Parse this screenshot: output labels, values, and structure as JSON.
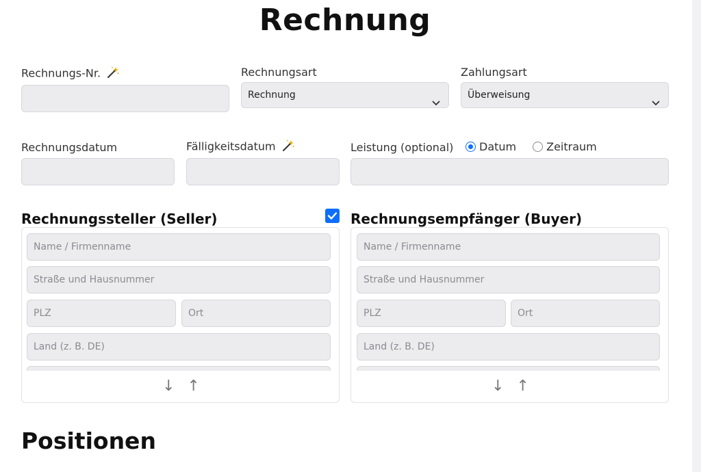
{
  "header": {
    "title": "Rechnung"
  },
  "row1": {
    "invoice_no_label": "Rechnungs-Nr.",
    "invoice_type_label": "Rechnungsart",
    "invoice_type_value": "Rechnung",
    "payment_type_label": "Zahlungsart",
    "payment_type_value": "Überweisung"
  },
  "row2": {
    "invoice_date_label": "Rechnungsdatum",
    "due_date_label": "Fälligkeitsdatum",
    "service_label": "Leistung (optional)",
    "radio_date": "Datum",
    "radio_period": "Zeitraum",
    "selected": "Datum"
  },
  "seller": {
    "title": "Rechnungssteller (Seller)",
    "checkbox_checked": true,
    "name_placeholder": "Name / Firmenname",
    "street_placeholder": "Straße und Hausnummer",
    "zip_placeholder": "PLZ",
    "city_placeholder": "Ort",
    "country_placeholder": "Land (z. B. DE)"
  },
  "buyer": {
    "title": "Rechnungsempfänger (Buyer)",
    "name_placeholder": "Name / Firmenname",
    "street_placeholder": "Straße und Hausnummer",
    "zip_placeholder": "PLZ",
    "city_placeholder": "Ort",
    "country_placeholder": "Land (z. B. DE)"
  },
  "arrows": {
    "down": "↓",
    "up": "↑"
  },
  "positions": {
    "title": "Positionen"
  },
  "colors": {
    "accent": "#0d6efd",
    "field_bg": "#ececef",
    "field_border": "#d7d7dc"
  },
  "icons": [
    "magic-wand-icon",
    "chevron-down-icon",
    "checkmark-icon",
    "arrow-down-icon",
    "arrow-up-icon"
  ]
}
